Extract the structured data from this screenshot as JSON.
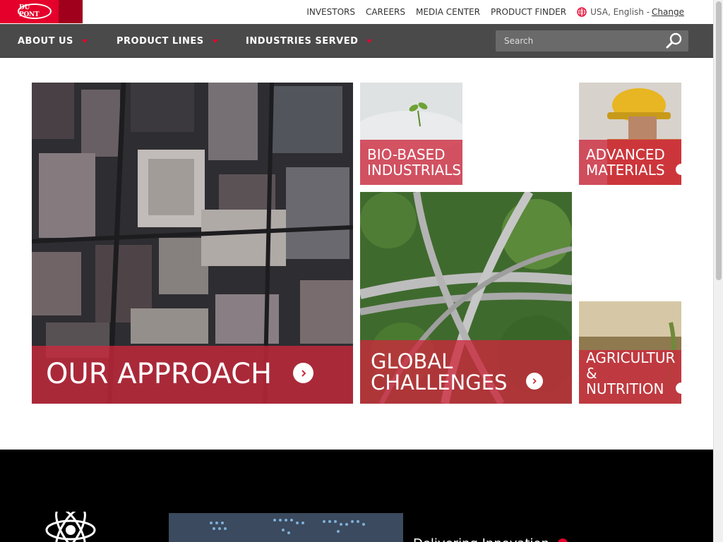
{
  "brand": {
    "logo_text": "DU PONT",
    "accent": "#e4002b"
  },
  "utility": {
    "links": [
      "INVESTORS",
      "CAREERS",
      "MEDIA CENTER",
      "PRODUCT FINDER"
    ],
    "locale": "USA, English -",
    "change": "Change"
  },
  "nav": {
    "items": [
      "ABOUT US",
      "PRODUCT LINES",
      "INDUSTRIES SERVED"
    ],
    "search_placeholder": "Search"
  },
  "tiles": {
    "approach": {
      "label": "OUR APPROACH"
    },
    "bio": {
      "line1": "BIO-BASED",
      "line2": "INDUSTRIALS"
    },
    "advanced": {
      "line1": "ADVANCED",
      "line2": "MATERIALS"
    },
    "global": {
      "line1": "GLOBAL",
      "line2": "CHALLENGES"
    },
    "agri": {
      "line1": "AGRICULTUR",
      "line2": "&",
      "line3": "NUTRITION"
    }
  },
  "footer": {
    "teaser": "Delivering Innovation"
  },
  "colors": {
    "nav_bg": "#4a4a4a",
    "tile_band": "#cd283c",
    "footer_bg": "#000000"
  }
}
